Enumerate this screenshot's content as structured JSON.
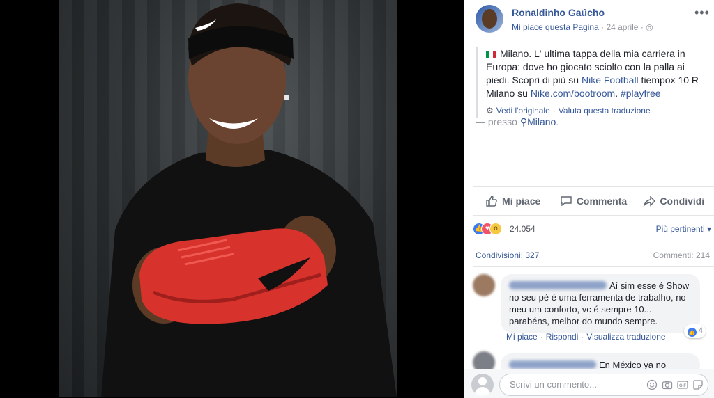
{
  "post": {
    "author": "Ronaldinho Gaúcho",
    "subtitle_link": "Mi piace questa Pagina",
    "date": "24 aprile",
    "text_intro": "Milano. L' ultima tappa della mia carriera in Europa: dove ho giocato sciolto con la palla ai piedi. Scopri di più su ",
    "link_nike_football": "Nike Football",
    "text_mid": " tiempox 10 R Milano su ",
    "link_nike": "Nike.com/bootroom",
    "text_dot": ". ",
    "hashtag": "#playfree",
    "see_original": "Vedi l'originale",
    "rate_translation": "Valuta questa traduzione",
    "location_prefix": "— presso",
    "location": "Milano",
    "location_suffix": "."
  },
  "actions": {
    "like": "Mi piace",
    "comment": "Commenta",
    "share": "Condividi"
  },
  "stats": {
    "reactions": "24.054",
    "relevance": "Più pertinenti",
    "shares": "Condivisioni: 327",
    "comments": "Commenti: 214"
  },
  "comments": [
    {
      "text": "Aí sim esse é Show no seu pé é uma ferramenta de trabalho, no meu um conforto, vc é sempre 10... parabéns, melhor do mundo sempre.",
      "like": "Mi piace",
      "reply": "Rispondi",
      "see_translation": "Visualizza traduzione",
      "reaction_count": "4"
    },
    {
      "text": "En México ya no"
    }
  ],
  "composer": {
    "placeholder": "Scrivi un commento..."
  },
  "colors": {
    "link": "#365899",
    "like_blue": "#3b7bf1",
    "love_red": "#f25268",
    "wow_yellow": "#f7c940"
  }
}
